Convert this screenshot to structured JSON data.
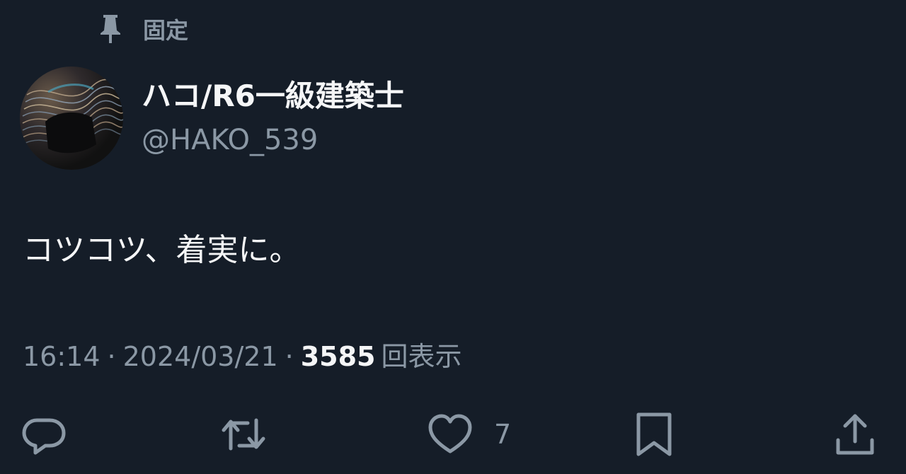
{
  "pinned": {
    "label": "固定",
    "icon": "pin-icon"
  },
  "user": {
    "display_name": "ハコ/R6一級建築士",
    "handle": "@HAKO_539",
    "avatar": "avatar"
  },
  "tweet": {
    "text": "コツコツ、着実に。"
  },
  "meta": {
    "time": "16:14",
    "separator": "·",
    "date": "2024/03/21",
    "views_count": "3585",
    "views_label": "回表示"
  },
  "actions": {
    "reply": {
      "icon": "reply-icon"
    },
    "retweet": {
      "icon": "retweet-icon"
    },
    "like": {
      "icon": "heart-icon",
      "count": "7"
    },
    "bookmark": {
      "icon": "bookmark-icon"
    },
    "share": {
      "icon": "share-icon"
    }
  },
  "colors": {
    "background": "#151d28",
    "primary_text": "#f5f6f7",
    "secondary_text": "#8b98a5"
  }
}
